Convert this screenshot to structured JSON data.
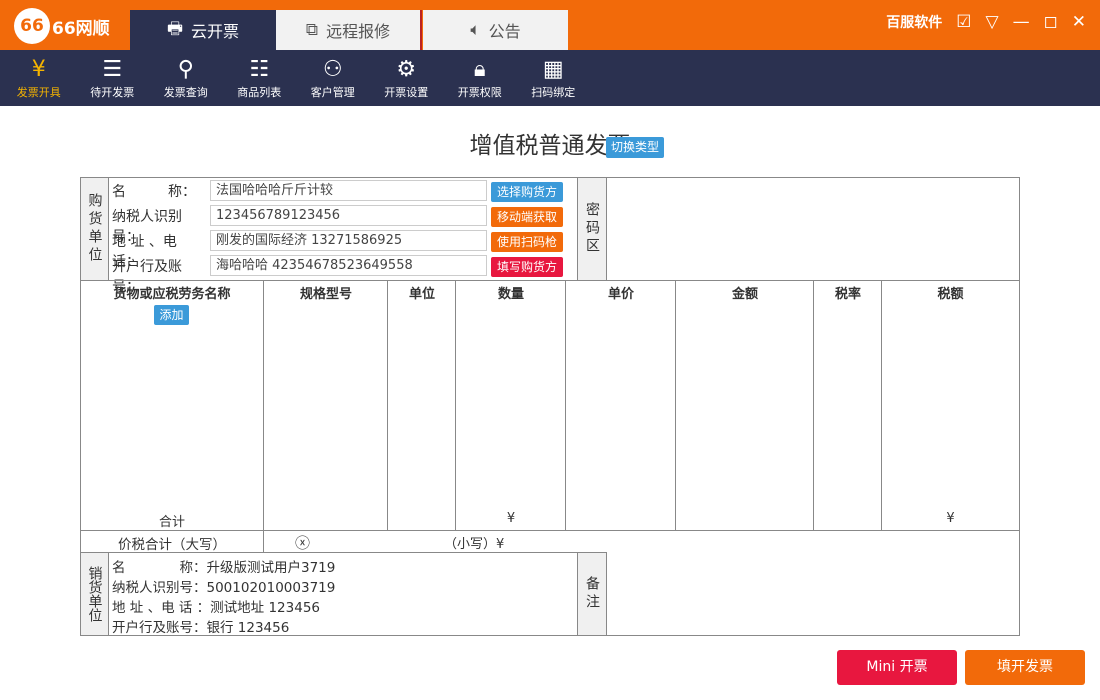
{
  "app": {
    "logo": "66网顺",
    "logo_mark": "66",
    "brand": "百服软件"
  },
  "tabs": [
    {
      "label": "云开票",
      "icon": "printer-icon"
    },
    {
      "label": "远程报修",
      "icon": "remote-icon"
    },
    {
      "label": "公告",
      "icon": "speaker-icon"
    }
  ],
  "nav": [
    {
      "label": "发票开具",
      "icon": "yen-receipt-icon"
    },
    {
      "label": "待开发票",
      "icon": "receipt-icon"
    },
    {
      "label": "发票查询",
      "icon": "search-icon"
    },
    {
      "label": "商品列表",
      "icon": "list-icon"
    },
    {
      "label": "客户管理",
      "icon": "users-icon"
    },
    {
      "label": "开票设置",
      "icon": "gear-icon"
    },
    {
      "label": "开票权限",
      "icon": "lock-icon"
    },
    {
      "label": "扫码绑定",
      "icon": "qr-icon"
    }
  ],
  "invoice": {
    "title": "增值税普通发票",
    "switch": "切换类型",
    "buyer": {
      "label": "购货单位",
      "fields": [
        {
          "label": "名　　　称：",
          "value": "法国哈哈哈斤斤计较"
        },
        {
          "label": "纳税人识别号：",
          "value": "123456789123456"
        },
        {
          "label": "地 址 、电 话：",
          "value": "刚发的国际经济 13271586925"
        },
        {
          "label": "开户行及账号：",
          "value": "海哈哈哈 42354678523649558"
        }
      ],
      "buttons": [
        "选择购货方",
        "移动端获取",
        "使用扫码枪",
        "填写购货方"
      ]
    },
    "password_area": "密码区",
    "columns": [
      "货物或应税劳务名称",
      "规格型号",
      "单位",
      "数量",
      "单价",
      "金额",
      "税率",
      "税额"
    ],
    "add": "添加",
    "total": "合计",
    "yen": "¥",
    "yen2": "¥",
    "sum_label": "价税合计（大写）",
    "sum_icon": "ⓧ",
    "small_label": "（小写）¥",
    "seller": {
      "label": "销货单位",
      "fields": [
        {
          "label": "名　　　　称：",
          "value": "升级版测试用户3719"
        },
        {
          "label": "纳税人识别号：",
          "value": "500102010003719"
        },
        {
          "label": "地 址 、电 话 ：",
          "value": "测试地址 123456"
        },
        {
          "label": "开户行及账号：",
          "value": "银行 123456"
        }
      ]
    },
    "remark": "备注"
  },
  "footer": {
    "mini": "Mini 开票",
    "fill": "填开发票"
  },
  "colors": {
    "orange": "#f26a0a",
    "navy": "#2b3150",
    "blue": "#3b9ad9",
    "red": "#e8173f"
  }
}
